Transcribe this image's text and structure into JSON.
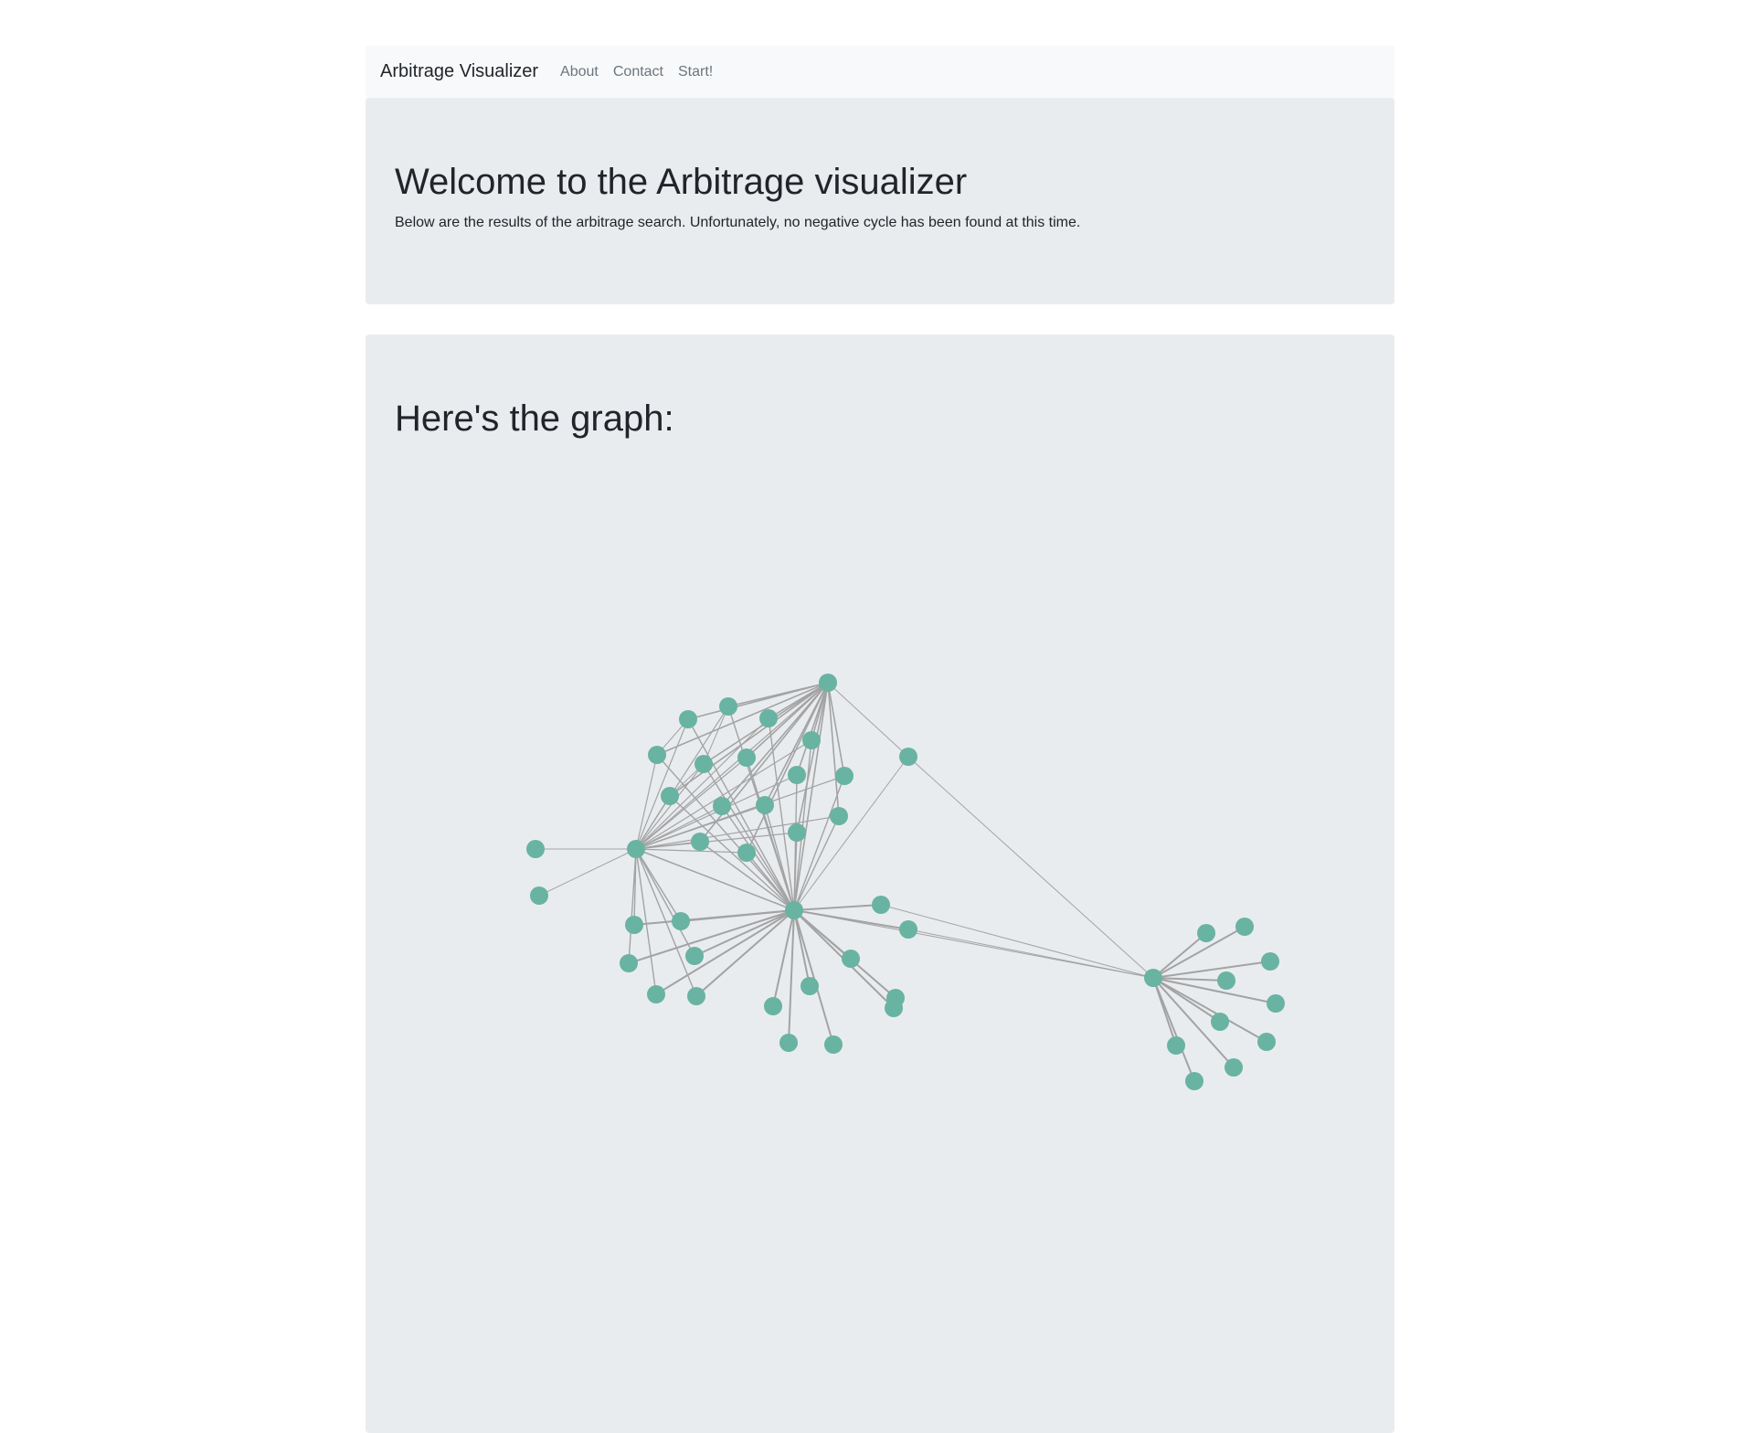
{
  "navbar": {
    "brand": "Arbitrage Visualizer",
    "links": [
      "About",
      "Contact",
      "Start!"
    ]
  },
  "header": {
    "title": "Welcome to the Arbitrage visualizer",
    "message": "Below are the results of the arbitrage search. Unfortunately, no negative cycle has been found at this time."
  },
  "graph_section": {
    "title": "Here's the graph:"
  },
  "colors": {
    "node": "#69b3a2",
    "edge": "#a3a3a3",
    "panel": "#e9ecef",
    "navbar": "#f8f9fa"
  }
}
